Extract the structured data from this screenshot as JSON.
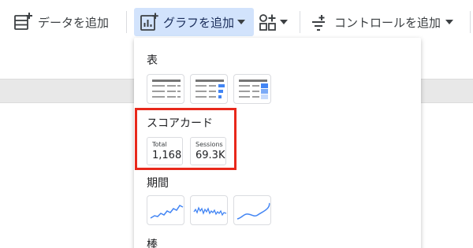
{
  "toolbar": {
    "add_data_label": "データを追加",
    "add_chart_label": "グラフを追加",
    "add_control_label": "コントロールを追加",
    "icons": [
      "add-data-icon",
      "add-chart-icon",
      "shapes-icon",
      "control-icon",
      "caret-down-icon"
    ]
  },
  "chart_menu": {
    "sections": [
      {
        "title": "表",
        "options": [
          "table",
          "table-with-bars",
          "table-with-heatmap"
        ]
      },
      {
        "title": "スコアカード",
        "options": [
          "scorecard",
          "scorecard-compact"
        ]
      },
      {
        "title": "期間",
        "options": [
          "time-series",
          "sparkline",
          "smoothed-line"
        ]
      },
      {
        "title": "棒"
      }
    ],
    "scorecards": [
      {
        "label": "Total",
        "value": "1,168"
      },
      {
        "label": "Sessions",
        "value": "69.3K"
      }
    ]
  },
  "colors": {
    "accent": "#4285f4",
    "selected_bg": "#d2e3fc",
    "highlight": "#e8281b"
  }
}
